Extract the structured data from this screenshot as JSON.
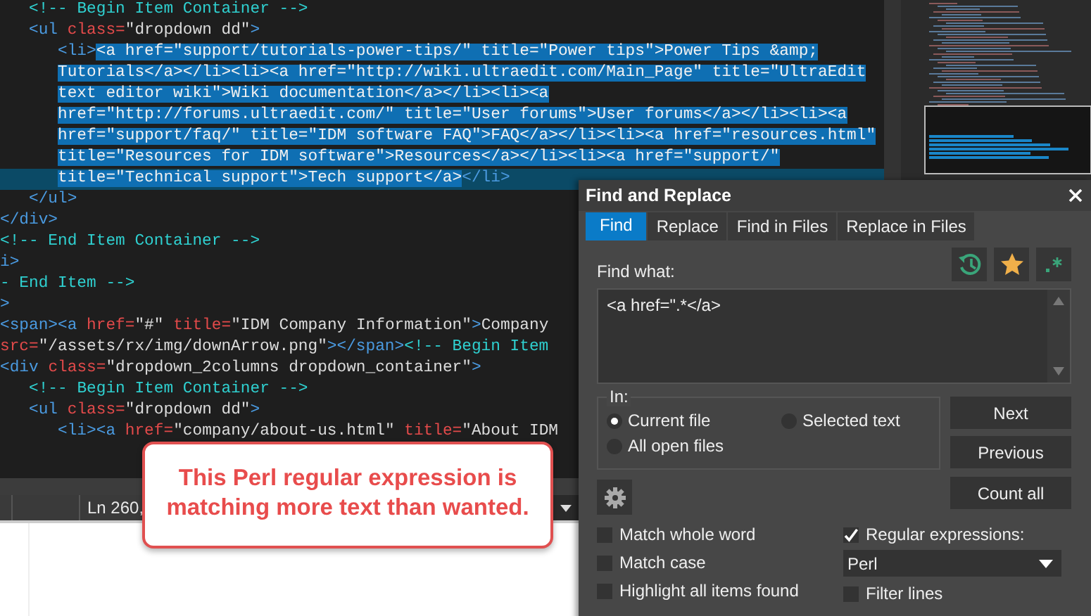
{
  "editor": {
    "lines": [
      {
        "current": false,
        "segments": [
          {
            "kind": "comment",
            "text": "   <!-- Begin Item Container -->",
            "selected": false
          }
        ]
      },
      {
        "current": false,
        "segments": [
          {
            "kind": "tag",
            "text": "   <ul",
            "selected": false
          },
          {
            "kind": "attr",
            "text": " class=",
            "selected": false
          },
          {
            "kind": "string",
            "text": "\"dropdown dd\"",
            "selected": false
          },
          {
            "kind": "tag",
            "text": ">",
            "selected": false
          }
        ]
      },
      {
        "current": false,
        "segments": [
          {
            "kind": "tag",
            "text": "      <li>",
            "selected": false
          },
          {
            "kind": "text",
            "text": "<a href=\"support/tutorials-power-tips/\" title=\"Power tips\">Power Tips &amp;",
            "selected": true
          }
        ]
      },
      {
        "current": false,
        "segments": [
          {
            "kind": "text",
            "text": "      Tutorials</a></li><li><a href=\"http://wiki.ultraedit.com/Main_Page\" title=\"UltraEdit",
            "selected": true
          }
        ]
      },
      {
        "current": false,
        "segments": [
          {
            "kind": "text",
            "text": "      text editor wiki\">Wiki documentation</a></li><li><a",
            "selected": true
          }
        ]
      },
      {
        "current": false,
        "segments": [
          {
            "kind": "text",
            "text": "      href=\"http://forums.ultraedit.com/\" title=\"User forums\">User forums</a></li><li><a",
            "selected": true
          }
        ]
      },
      {
        "current": false,
        "segments": [
          {
            "kind": "text",
            "text": "      href=\"support/faq/\" title=\"IDM software FAQ\">FAQ</a></li><li><a href=\"resources.html\"",
            "selected": true
          }
        ]
      },
      {
        "current": false,
        "segments": [
          {
            "kind": "text",
            "text": "      title=\"Resources for IDM software\">Resources</a></li><li><a href=\"support/\"",
            "selected": true
          }
        ]
      },
      {
        "current": true,
        "segments": [
          {
            "kind": "text",
            "text": "      title=\"Technical support\">Tech support</a>",
            "selected": true
          },
          {
            "kind": "tag",
            "text": "</li>",
            "selected": false
          }
        ]
      },
      {
        "current": false,
        "segments": [
          {
            "kind": "tag",
            "text": "   </ul>",
            "selected": false
          }
        ]
      },
      {
        "current": false,
        "segments": [
          {
            "kind": "tag",
            "text": "</div>",
            "selected": false
          }
        ]
      },
      {
        "current": false,
        "segments": [
          {
            "kind": "comment",
            "text": "<!-- End Item Container -->",
            "selected": false
          }
        ]
      },
      {
        "current": false,
        "segments": [
          {
            "kind": "tag",
            "text": "i>",
            "selected": false
          }
        ]
      },
      {
        "current": false,
        "segments": [
          {
            "kind": "comment",
            "text": "- End Item -->",
            "selected": false
          }
        ]
      },
      {
        "current": false,
        "segments": [
          {
            "kind": "tag",
            "text": ">",
            "selected": false
          }
        ]
      },
      {
        "current": false,
        "segments": [
          {
            "kind": "tag",
            "text": "<span><a",
            "selected": false
          },
          {
            "kind": "attr",
            "text": " href=",
            "selected": false
          },
          {
            "kind": "string",
            "text": "\"#\"",
            "selected": false
          },
          {
            "kind": "attr",
            "text": " title=",
            "selected": false
          },
          {
            "kind": "string",
            "text": "\"IDM Company Information\"",
            "selected": false
          },
          {
            "kind": "tag",
            "text": ">",
            "selected": false
          },
          {
            "kind": "text",
            "text": "Company",
            "selected": false
          }
        ]
      },
      {
        "current": false,
        "segments": [
          {
            "kind": "attr",
            "text": "src=",
            "selected": false
          },
          {
            "kind": "string",
            "text": "\"/assets/rx/img/downArrow.png\"",
            "selected": false
          },
          {
            "kind": "tag",
            "text": "></span>",
            "selected": false
          },
          {
            "kind": "comment",
            "text": "<!-- Begin Item",
            "selected": false
          }
        ]
      },
      {
        "current": false,
        "segments": [
          {
            "kind": "tag",
            "text": "<div",
            "selected": false
          },
          {
            "kind": "attr",
            "text": " class=",
            "selected": false
          },
          {
            "kind": "string",
            "text": "\"dropdown_2columns dropdown_container\"",
            "selected": false
          },
          {
            "kind": "tag",
            "text": ">",
            "selected": false
          }
        ]
      },
      {
        "current": false,
        "segments": [
          {
            "kind": "comment",
            "text": "   <!-- Begin Item Container -->",
            "selected": false
          }
        ]
      },
      {
        "current": false,
        "segments": [
          {
            "kind": "tag",
            "text": "   <ul",
            "selected": false
          },
          {
            "kind": "attr",
            "text": " class=",
            "selected": false
          },
          {
            "kind": "string",
            "text": "\"dropdown dd\"",
            "selected": false
          },
          {
            "kind": "tag",
            "text": ">",
            "selected": false
          }
        ]
      },
      {
        "current": false,
        "segments": [
          {
            "kind": "tag",
            "text": "      <li><a",
            "selected": false
          },
          {
            "kind": "attr",
            "text": " href=",
            "selected": false
          },
          {
            "kind": "string",
            "text": "\"company/about-us.html\"",
            "selected": false
          },
          {
            "kind": "attr",
            "text": " title=",
            "selected": false
          },
          {
            "kind": "string",
            "text": "\"About IDM",
            "selected": false
          }
        ]
      }
    ]
  },
  "status_bar": {
    "position": "Ln 260,"
  },
  "dialog": {
    "title": "Find and Replace",
    "tabs": [
      {
        "label": "Find",
        "selected": true
      },
      {
        "label": "Replace",
        "selected": false
      },
      {
        "label": "Find in Files",
        "selected": false
      },
      {
        "label": "Replace in Files",
        "selected": false
      }
    ],
    "find_label": "Find what:",
    "find_value": "<a href=\".*</a>",
    "scope": {
      "label": "In:",
      "options": [
        {
          "label": "Current file",
          "selected": true
        },
        {
          "label": "Selected text",
          "selected": false
        },
        {
          "label": "All open files",
          "selected": false
        }
      ]
    },
    "buttons": [
      "Next",
      "Previous",
      "Count all"
    ],
    "options": [
      {
        "label": "Match whole word",
        "checked": false
      },
      {
        "label": "Match case",
        "checked": false
      },
      {
        "label": "Highlight all items found",
        "checked": false
      }
    ],
    "regex": {
      "label": "Regular expressions:",
      "checked": true,
      "engine": "Perl"
    },
    "filter": {
      "label": "Filter lines",
      "checked": false
    }
  },
  "callout": {
    "text": "This Perl regular expression is matching more text than wanted."
  }
}
